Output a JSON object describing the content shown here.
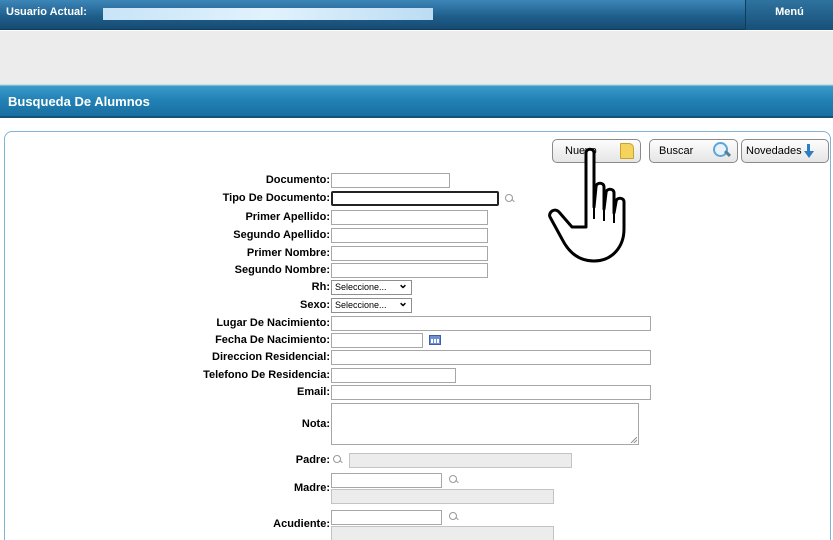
{
  "topbar": {
    "user_label": "Usuario Actual:",
    "menu_label": "Menú"
  },
  "page": {
    "title": "Busqueda De Alumnos"
  },
  "toolbar": {
    "nuevo_label": "Nuevo",
    "buscar_label": "Buscar",
    "novedades_label": "Novedades"
  },
  "form": {
    "documento": "Documento:",
    "tipo_documento": "Tipo De Documento:",
    "primer_apellido": "Primer Apellido:",
    "segundo_apellido": "Segundo Apellido:",
    "primer_nombre": "Primer Nombre:",
    "segundo_nombre": "Segundo Nombre:",
    "rh": "Rh:",
    "sexo": "Sexo:",
    "lugar_nacimiento": "Lugar De Nacimiento:",
    "fecha_nacimiento": "Fecha De Nacimiento:",
    "direccion": "Direccion Residencial:",
    "telefono": "Telefono De Residencia:",
    "email": "Email:",
    "nota": "Nota:",
    "padre": "Padre:",
    "madre": "Madre:",
    "acudiente": "Acudiente:",
    "rh_selected": "Seleccione...",
    "sexo_selected": "Seleccione..."
  },
  "icons": {
    "nuevo": "note-icon",
    "buscar": "magnifier-icon",
    "novedades": "arrow-down-icon",
    "cursor": "hand-pointer-icon",
    "calendar": "calendar-icon"
  },
  "colors": {
    "header_blue": "#1f5f8c",
    "title_blue": "#2282b6",
    "panel_border": "#7fb4d4"
  }
}
